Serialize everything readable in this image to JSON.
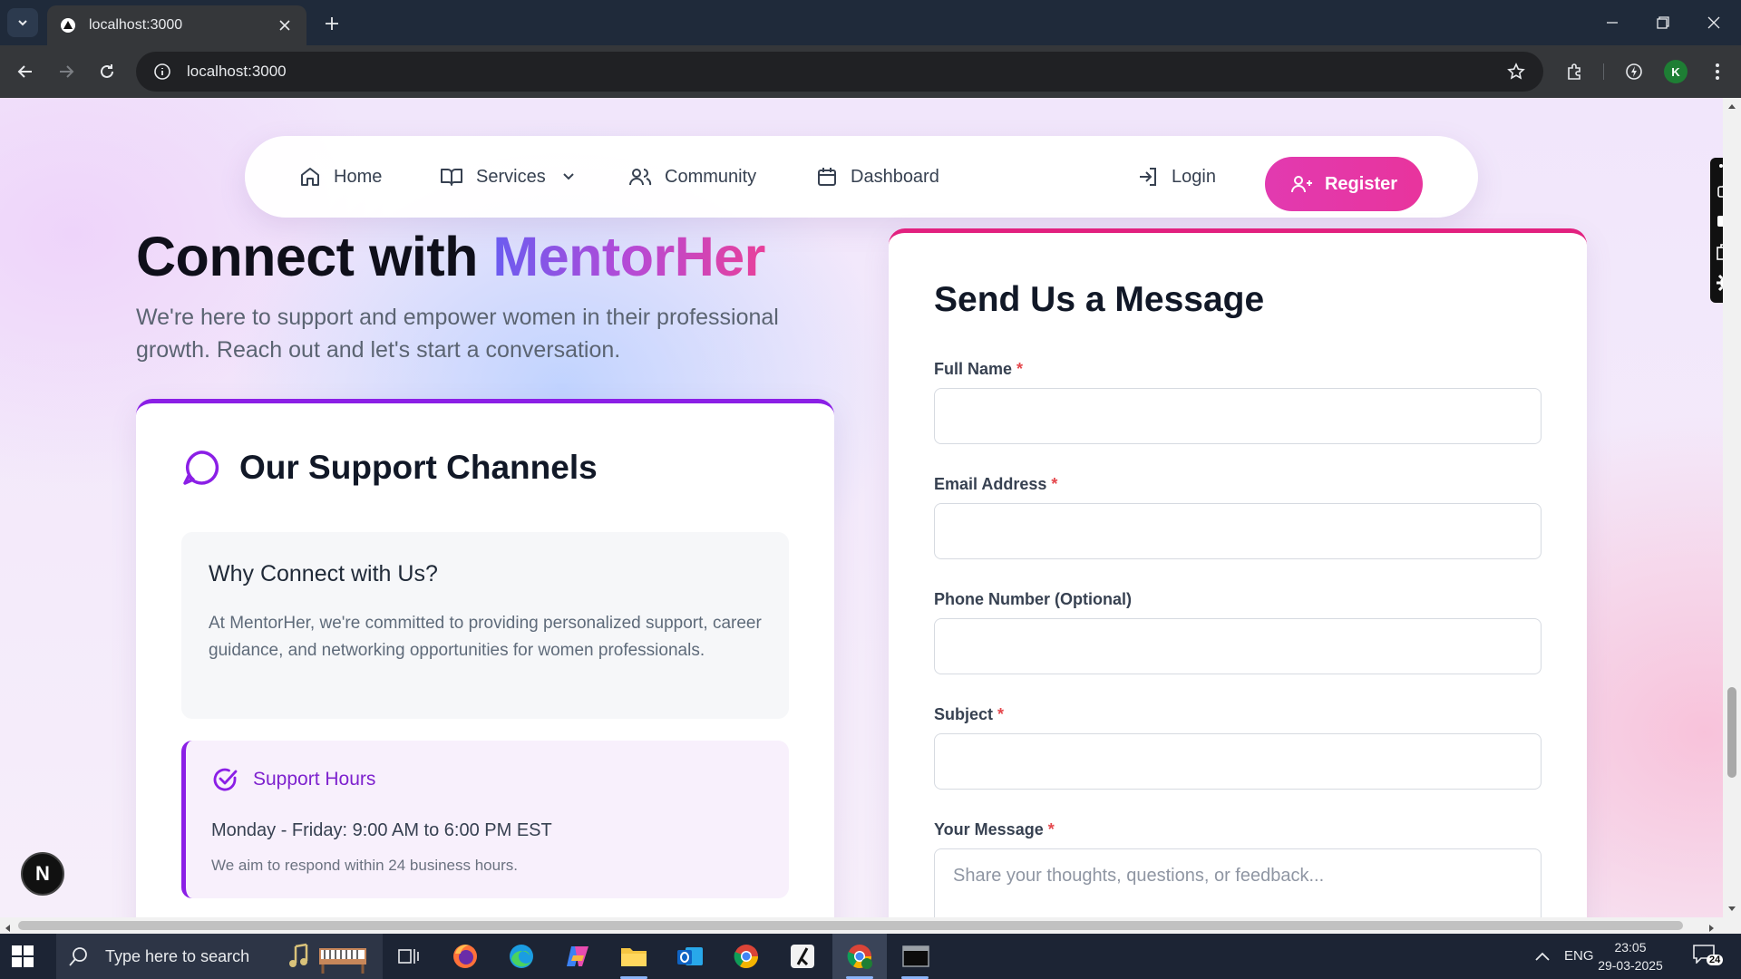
{
  "browser": {
    "tab_title": "localhost:3000",
    "url": "localhost:3000",
    "profile_initial": "K"
  },
  "nav": {
    "home": "Home",
    "services": "Services",
    "community": "Community",
    "dashboard": "Dashboard",
    "login": "Login",
    "register": "Register"
  },
  "hero": {
    "title_prefix": "Connect with ",
    "title_brand": "MentorHer",
    "subtitle": "We're here to support and empower women in their professional growth. Reach out and let's start a conversation."
  },
  "support": {
    "heading": "Our Support Channels",
    "why_title": "Why Connect with Us?",
    "why_text": "At MentorHer, we're committed to providing personalized support, career guidance, and networking opportunities for women professionals.",
    "hours_title": "Support Hours",
    "hours_line": "Monday - Friday: 9:00 AM to 6:00 PM EST",
    "hours_note": "We aim to respond within 24 business hours."
  },
  "form": {
    "title": "Send Us a Message",
    "full_name_label": "Full Name",
    "email_label": "Email Address",
    "phone_label": "Phone Number (Optional)",
    "subject_label": "Subject",
    "message_label": "Your Message",
    "required_mark": "*",
    "full_name_value": "",
    "email_value": "",
    "phone_value": "",
    "subject_value": "",
    "message_placeholder": "Share your thoughts, questions, or feedback..."
  },
  "overlay": {
    "n_badge": "N"
  },
  "taskbar": {
    "search_placeholder": "Type here to search",
    "language": "ENG",
    "time": "23:05",
    "date": "29-03-2025",
    "notifications": "24"
  },
  "colors": {
    "accent_purple": "#8b1fe6",
    "accent_pink": "#e2217f",
    "register_pink": "#e23ab0"
  }
}
